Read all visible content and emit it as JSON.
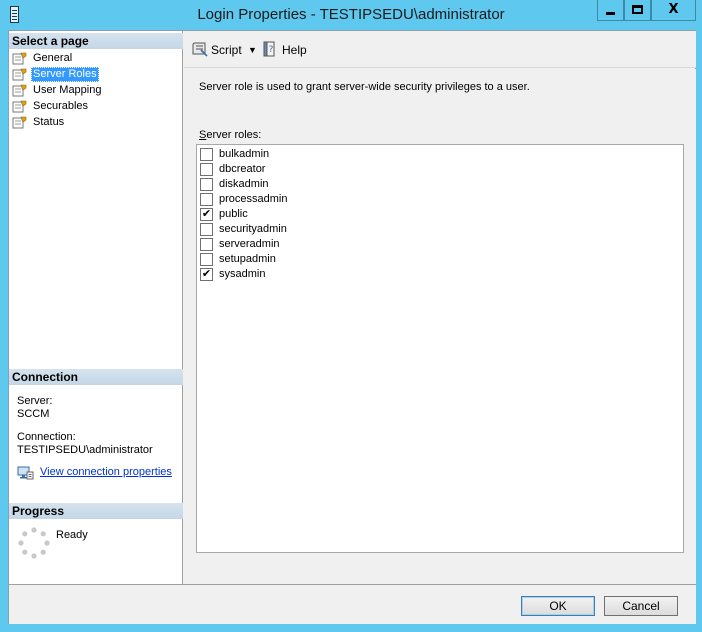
{
  "window": {
    "title": "Login Properties - TESTIPSEDU\\administrator",
    "controls": {
      "minimize": "minimize",
      "maximize": "maximize",
      "close": "X"
    }
  },
  "sidebar": {
    "header": "Select a page",
    "items": [
      {
        "label": "General",
        "icon": "page-wrench-icon"
      },
      {
        "label": "Server Roles",
        "icon": "page-wrench-icon",
        "selected": true
      },
      {
        "label": "User Mapping",
        "icon": "page-wrench-icon"
      },
      {
        "label": "Securables",
        "icon": "page-wrench-icon"
      },
      {
        "label": "Status",
        "icon": "page-wrench-icon"
      }
    ]
  },
  "connection": {
    "header": "Connection",
    "server_label": "Server:",
    "server_value": "SCCM",
    "connection_label": "Connection:",
    "connection_value": "TESTIPSEDU\\administrator",
    "link_text": "View connection properties"
  },
  "progress": {
    "header": "Progress",
    "status": "Ready"
  },
  "toolbar": {
    "script_label": "Script",
    "help_label": "Help"
  },
  "main": {
    "description": "Server role is used to grant server-wide security privileges to a user.",
    "roles_label": "Server roles:",
    "roles": [
      {
        "name": "bulkadmin",
        "checked": false
      },
      {
        "name": "dbcreator",
        "checked": false
      },
      {
        "name": "diskadmin",
        "checked": false
      },
      {
        "name": "processadmin",
        "checked": false
      },
      {
        "name": "public",
        "checked": true
      },
      {
        "name": "securityadmin",
        "checked": false
      },
      {
        "name": "serveradmin",
        "checked": false
      },
      {
        "name": "setupadmin",
        "checked": false
      },
      {
        "name": "sysadmin",
        "checked": true
      }
    ]
  },
  "footer": {
    "ok_label": "OK",
    "cancel_label": "Cancel"
  },
  "colors": {
    "titlebar": "#5ec8ee",
    "selection": "#3399ff",
    "link": "#0033cc"
  }
}
